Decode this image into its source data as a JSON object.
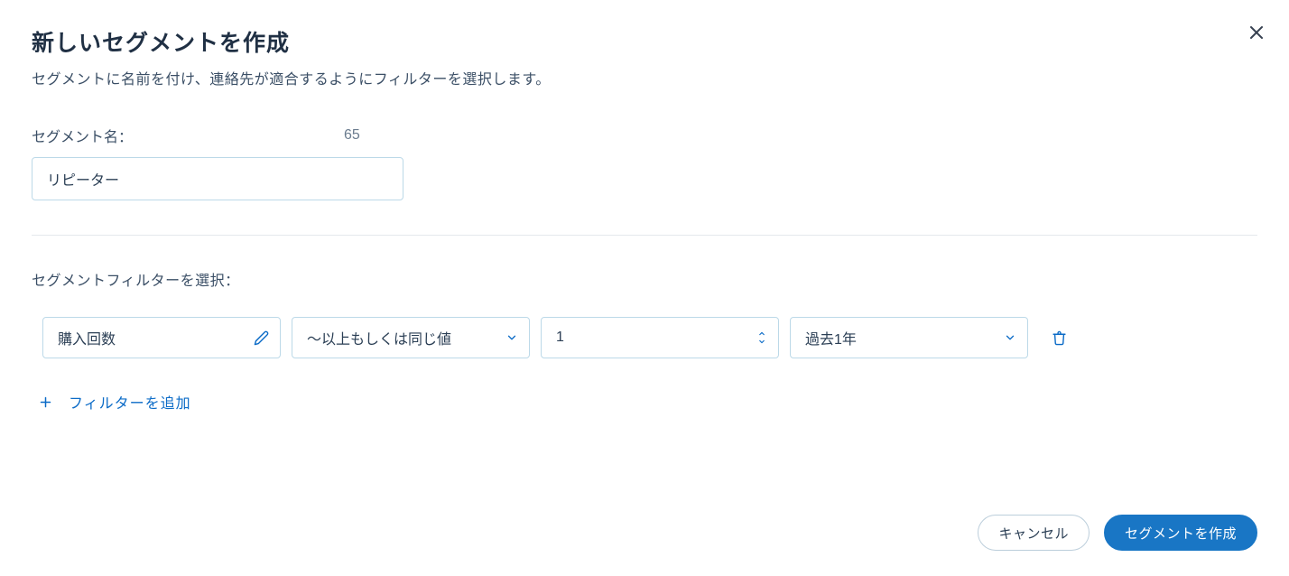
{
  "header": {
    "title": "新しいセグメントを作成",
    "subtitle": "セグメントに名前を付け、連絡先が適合するようにフィルターを選択します。"
  },
  "segment_name": {
    "label": "セグメント名：",
    "value": "リピーター",
    "char_count": "65"
  },
  "filter_section": {
    "label": "セグメントフィルターを選択："
  },
  "filter": {
    "attribute": "購入回数",
    "operator": "〜以上もしくは同じ値",
    "value": "1",
    "period": "過去1年"
  },
  "add_filter_label": "フィルターを追加",
  "footer": {
    "cancel": "キャンセル",
    "submit": "セグメントを作成"
  }
}
